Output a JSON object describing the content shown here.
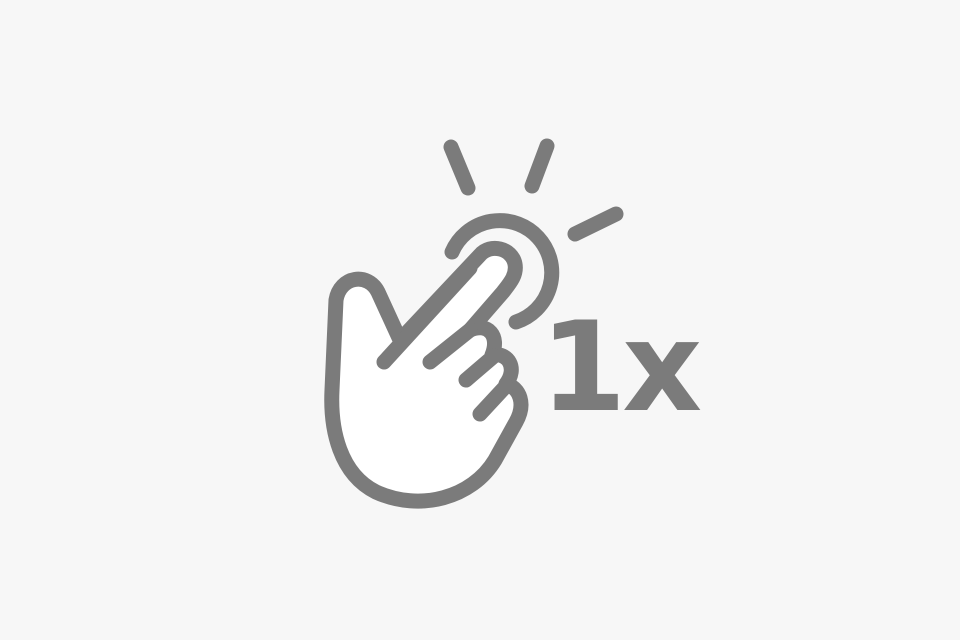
{
  "illustration": {
    "icon": "single-tap-gesture-icon",
    "count_label": "1x"
  },
  "colors": {
    "background": "#f7f7f7",
    "stroke": "#7b7b7b",
    "hand_fill": "#ffffff"
  }
}
